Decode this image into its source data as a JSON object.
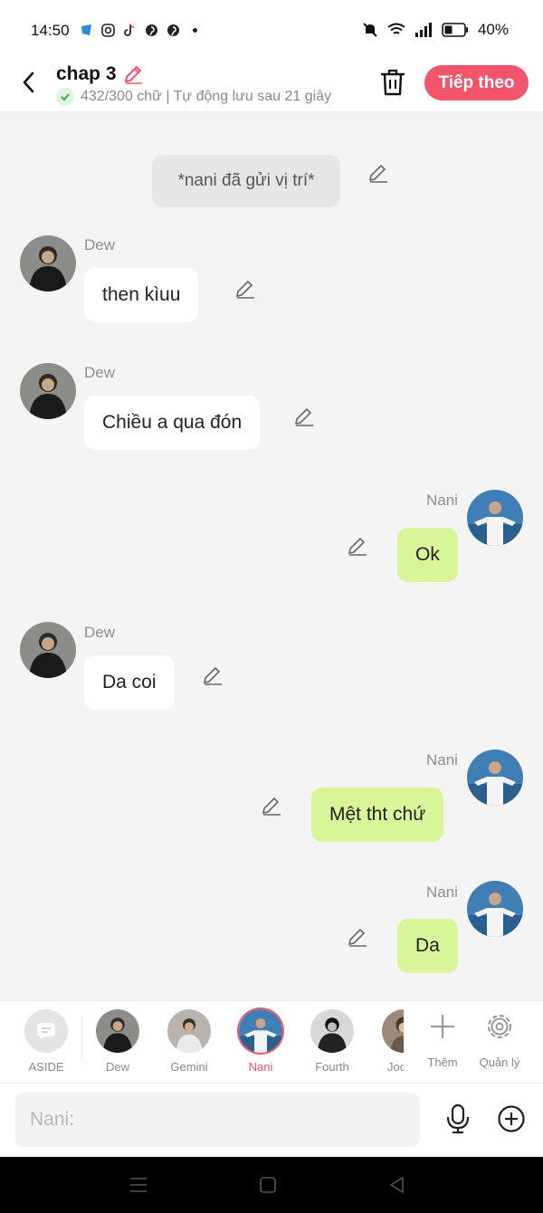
{
  "status_bar": {
    "time": "14:50",
    "battery": "40%",
    "app_icons": [
      "messenger-icon",
      "instagram-icon",
      "tiktok-icon",
      "pinterest-icon",
      "pinterest-icon"
    ],
    "right_icons": [
      "mute-icon",
      "wifi-icon",
      "signal-icon",
      "battery-icon"
    ]
  },
  "header": {
    "title": "chap 3",
    "subtitle": "432/300 chữ | Tự động lưu sau 21 giây",
    "next_label": "Tiếp theo"
  },
  "chat": {
    "system_message": "*nani đã gửi vị trí*",
    "messages": [
      {
        "sender": "Dew",
        "text": "then kìuu",
        "side": "left"
      },
      {
        "sender": "Dew",
        "text": "Chiều a qua đón",
        "side": "left"
      },
      {
        "sender": "Nani",
        "text": "Ok",
        "side": "right"
      },
      {
        "sender": "Dew",
        "text": "Da coi",
        "side": "left"
      },
      {
        "sender": "Nani",
        "text": "Mệt tht chứ",
        "side": "right"
      },
      {
        "sender": "Nani",
        "text": "Da",
        "side": "right"
      }
    ]
  },
  "characters": {
    "aside_label": "ASIDE",
    "items": [
      {
        "name": "Dew"
      },
      {
        "name": "Gemini"
      },
      {
        "name": "Nani",
        "active": true
      },
      {
        "name": "Fourth"
      },
      {
        "name": "Joo"
      }
    ],
    "add_label": "Thêm",
    "manage_label": "Quản lý"
  },
  "input": {
    "placeholder": "Nani:"
  },
  "colors": {
    "accent": "#f2556b",
    "right_bubble": "#d8f59a",
    "left_bubble": "#ffffff",
    "background": "#f4f4f4"
  }
}
